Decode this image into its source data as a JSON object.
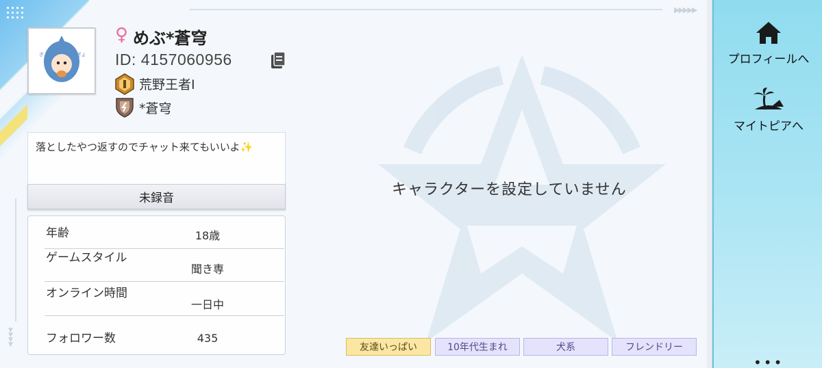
{
  "profile": {
    "gender_symbol": "♀",
    "username": "めぶ*蒼穹",
    "id_text": "ID: 4157060956",
    "rank": "荒野王者Ⅰ",
    "clan": "*蒼穹",
    "bio": "落としたやつ返すのでチャット来てもいいよ✨",
    "voice_label": "未録音"
  },
  "stats": [
    {
      "label": "年齢",
      "value": "18歳"
    },
    {
      "label": "ゲームスタイル",
      "value": "聞き専"
    },
    {
      "label": "オンライン時間",
      "value": "一日中"
    },
    {
      "label": "フォロワー数",
      "value": "435"
    }
  ],
  "character": {
    "empty_message": "キャラクターを設定していません"
  },
  "tags": [
    "友達いっぱい",
    "10年代生まれ",
    "犬系",
    "フレンドリー"
  ],
  "sidebar": {
    "items": [
      {
        "label": "プロフィールへ",
        "icon": "home-icon"
      },
      {
        "label": "マイトピアへ",
        "icon": "island-icon"
      }
    ],
    "more": "•••"
  },
  "colors": {
    "accent": "#8fdcef",
    "gender": "#ef6a9c",
    "tag_gold": "#fbe7a3",
    "tag_purple": "#e5e2fb"
  }
}
